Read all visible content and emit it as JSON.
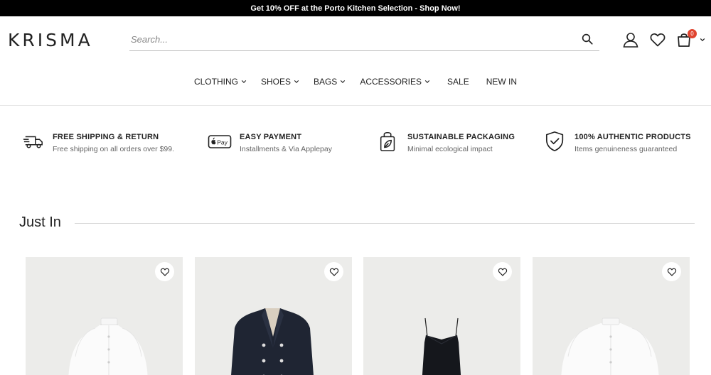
{
  "promo_bar": {
    "text": "Get 10% OFF at the Porto Kitchen Selection - Shop Now!"
  },
  "header": {
    "logo": "KRISMA",
    "search": {
      "placeholder": "Search...",
      "value": ""
    },
    "cart_count": "0",
    "icons": [
      "search-icon",
      "account-icon",
      "heart-icon",
      "cart-icon",
      "chevron-down-icon"
    ]
  },
  "nav": {
    "items": [
      {
        "label": "CLOTHING",
        "has_dropdown": true
      },
      {
        "label": "SHOES",
        "has_dropdown": true
      },
      {
        "label": "BAGS",
        "has_dropdown": true
      },
      {
        "label": "ACCESSORIES",
        "has_dropdown": true
      },
      {
        "label": "SALE",
        "has_dropdown": false
      },
      {
        "label": "NEW IN",
        "has_dropdown": false
      }
    ]
  },
  "features": [
    {
      "icon": "truck-icon",
      "title": "FREE SHIPPING & RETURN",
      "subtitle": "Free shipping on all orders over $99."
    },
    {
      "icon": "apple-pay-icon",
      "title": "EASY PAYMENT",
      "subtitle": "Installments & Via Applepay",
      "icon_text": "Pay"
    },
    {
      "icon": "eco-bag-icon",
      "title": "SUSTAINABLE PACKAGING",
      "subtitle": "Minimal ecological impact"
    },
    {
      "icon": "shield-check-icon",
      "title": "100% AUTHENTIC PRODUCTS",
      "subtitle": "Items genuineness guaranteed"
    }
  ],
  "just_in": {
    "title": "Just In",
    "products": [
      {
        "image": "white-blouse",
        "wishlist_icon": "heart-icon"
      },
      {
        "image": "navy-double-breasted-blazer",
        "wishlist_icon": "heart-icon"
      },
      {
        "image": "black-camisole",
        "wishlist_icon": "heart-icon"
      },
      {
        "image": "white-blouse",
        "wishlist_icon": "heart-icon"
      }
    ]
  },
  "colors": {
    "promo_bg": "#000000",
    "badge": "#e0442f",
    "product_bg": "#ececea",
    "text": "#222222"
  }
}
